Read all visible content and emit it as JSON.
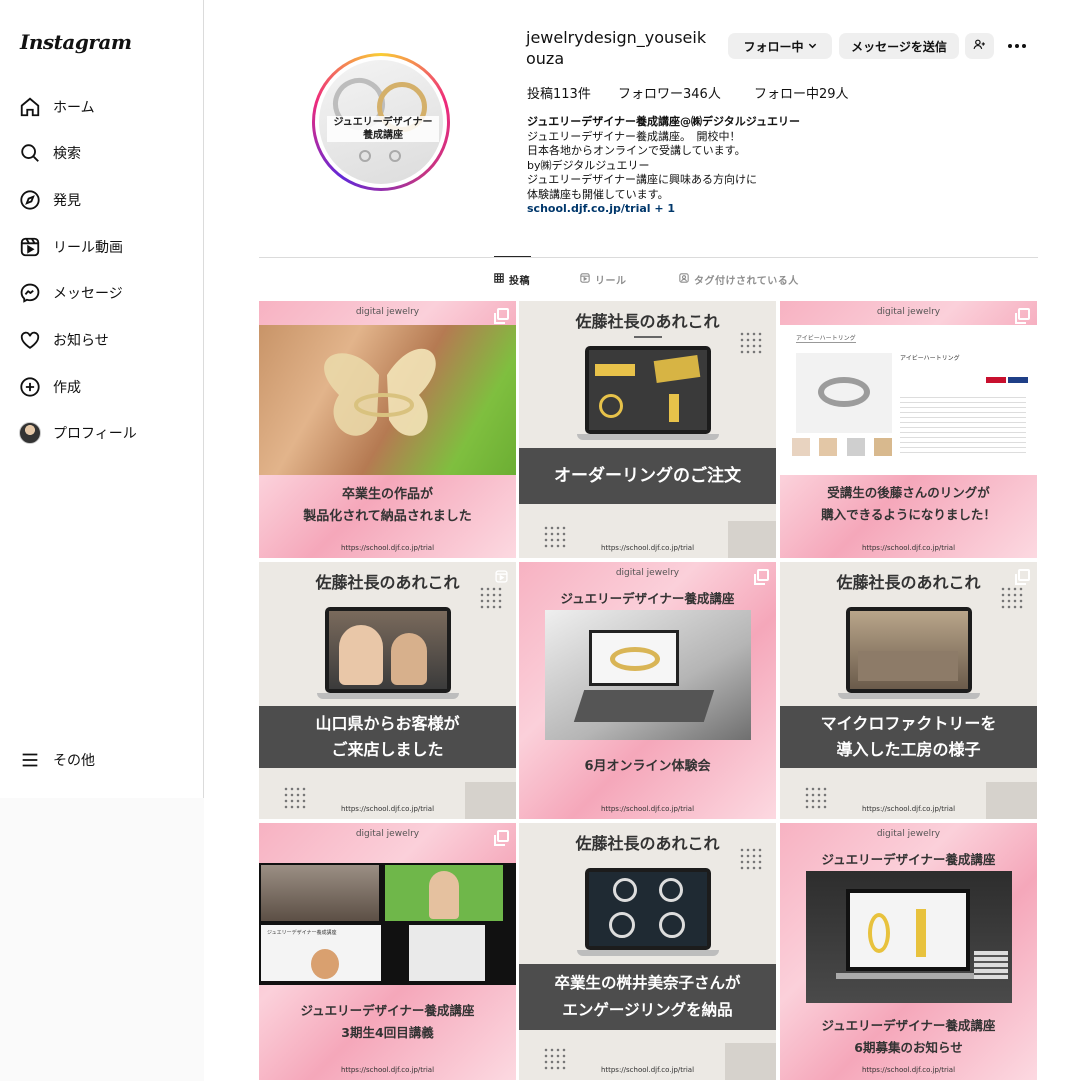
{
  "app": {
    "logo": "Instagram"
  },
  "sidebar": {
    "items": [
      {
        "label": "ホーム",
        "icon": "home-icon"
      },
      {
        "label": "検索",
        "icon": "search-icon"
      },
      {
        "label": "発見",
        "icon": "compass-icon"
      },
      {
        "label": "リール動画",
        "icon": "reels-icon"
      },
      {
        "label": "メッセージ",
        "icon": "messenger-icon"
      },
      {
        "label": "お知らせ",
        "icon": "heart-icon"
      },
      {
        "label": "作成",
        "icon": "plus-square-icon"
      },
      {
        "label": "プロフィール",
        "icon": "avatar"
      }
    ],
    "more_label": "その他"
  },
  "profile": {
    "username": "jewelrydesign_youseikouza",
    "picture_text_line1": "ジュエリーデザイナー",
    "picture_text_line2": "養成講座",
    "follow_button": "フォロー中",
    "message_button": "メッセージを送信",
    "stats": {
      "posts": "投稿113件",
      "followers": "フォロワー346人",
      "following": "フォロー中29人"
    },
    "bio": {
      "name": "ジュエリーデザイナー養成講座@㈱デジタルジュエリー",
      "lines": [
        "ジュエリーデザイナー養成講座。　開校中！",
        "日本各地からオンラインで受講しています。",
        "by㈱デジタルジュエリー",
        "ジュエリーデザイナー講座に興味ある方向けに",
        "体験講座も開催しています。"
      ],
      "link": "school.djf.co.jp/trial + 1"
    }
  },
  "tabs": [
    {
      "label": "投稿",
      "icon": "grid-icon",
      "active": true
    },
    {
      "label": "リール",
      "icon": "reels-icon",
      "active": false
    },
    {
      "label": "タグ付けされている人",
      "icon": "tag-icon",
      "active": false
    }
  ],
  "posts": {
    "brand": "digital jewelry",
    "url": "https://school.djf.co.jp/trial",
    "p1": {
      "line1": "卒業生の作品が",
      "line2": "製品化されて納品されました"
    },
    "p2": {
      "header": "佐藤社長のあれこれ",
      "band": "オーダーリングのご注文"
    },
    "p3": {
      "line1": "受講生の後藤さんのリングが",
      "line2": "購入できるようになりました！",
      "page_title": "アイビーハートリング",
      "product_title": "アイビーハートリング"
    },
    "p4": {
      "header": "佐藤社長のあれこれ",
      "line1": "山口県からお客様が",
      "line2": "ご来店しました"
    },
    "p5": {
      "header": "ジュエリーデザイナー養成講座",
      "caption": "6月オンライン体験会"
    },
    "p6": {
      "header": "佐藤社長のあれこれ",
      "line1": "マイクロファクトリーを",
      "line2": "導入した工房の様子"
    },
    "p7": {
      "line1": "ジュエリーデザイナー養成講座",
      "line2": "3期生4回目講義",
      "screen_label": "ジュエリーデザイナー養成講座"
    },
    "p8": {
      "header": "佐藤社長のあれこれ",
      "line1": "卒業生の桝井美奈子さんが",
      "line2": "エンゲージリングを納品"
    },
    "p9": {
      "header": "ジュエリーデザイナー養成講座",
      "line1": "ジュエリーデザイナー養成講座",
      "line2": "6期募集のお知らせ"
    }
  }
}
